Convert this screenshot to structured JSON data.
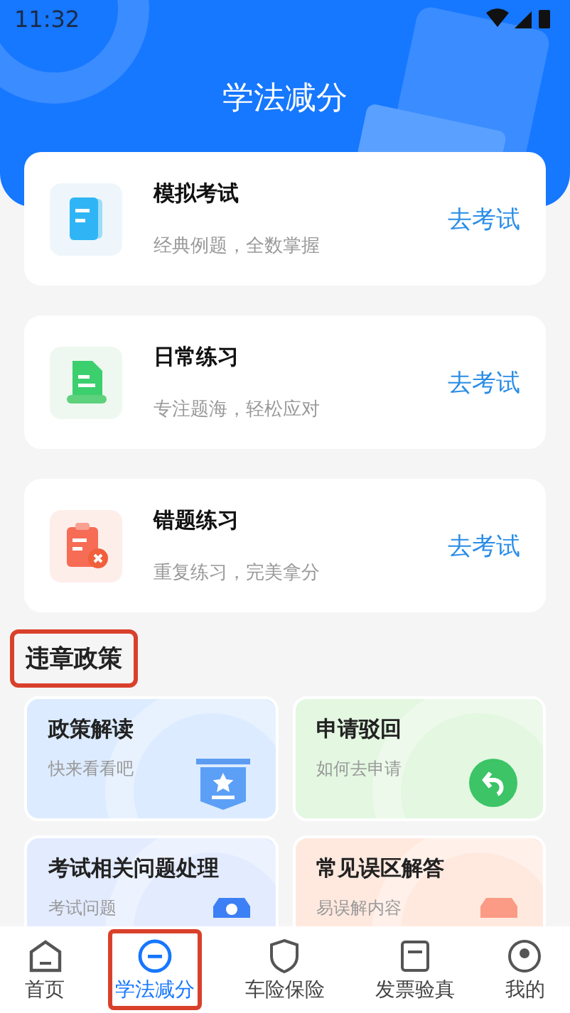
{
  "status_bar": {
    "time": "11:32"
  },
  "header": {
    "title": "学法减分"
  },
  "study_cards": [
    {
      "kind": "exam",
      "title": "模拟考试",
      "subtitle": "经典例题，全数掌握",
      "action": "去考试"
    },
    {
      "kind": "practice",
      "title": "日常练习",
      "subtitle": "专注题海，轻松应对",
      "action": "去考试"
    },
    {
      "kind": "mistakes",
      "title": "错题练习",
      "subtitle": "重复练习，完美拿分",
      "action": "去考试"
    }
  ],
  "policy_section": {
    "title": "违章政策",
    "outlined": true,
    "tiles": [
      {
        "kind": "policy",
        "title": "政策解读",
        "subtitle": "快来看看吧",
        "color": "#dcebff"
      },
      {
        "kind": "appeal",
        "title": "申请驳回",
        "subtitle": "如何去申请",
        "color": "#e3f7e1"
      },
      {
        "kind": "exam",
        "title": "考试相关问题处理",
        "subtitle": "考试问题",
        "color": "#e3ebff"
      },
      {
        "kind": "faq",
        "title": "常见误区解答",
        "subtitle": "易误解内容",
        "color": "#ffe9df"
      }
    ]
  },
  "tab_bar": [
    {
      "kind": "home",
      "label": "首页",
      "selected": false,
      "outlined": false
    },
    {
      "kind": "minus",
      "label": "学法减分",
      "selected": true,
      "outlined": true
    },
    {
      "kind": "shield",
      "label": "车险保险",
      "selected": false,
      "outlined": false
    },
    {
      "kind": "invoice",
      "label": "发票验真",
      "selected": false,
      "outlined": false
    },
    {
      "kind": "user",
      "label": "我的",
      "selected": false,
      "outlined": false
    }
  ]
}
